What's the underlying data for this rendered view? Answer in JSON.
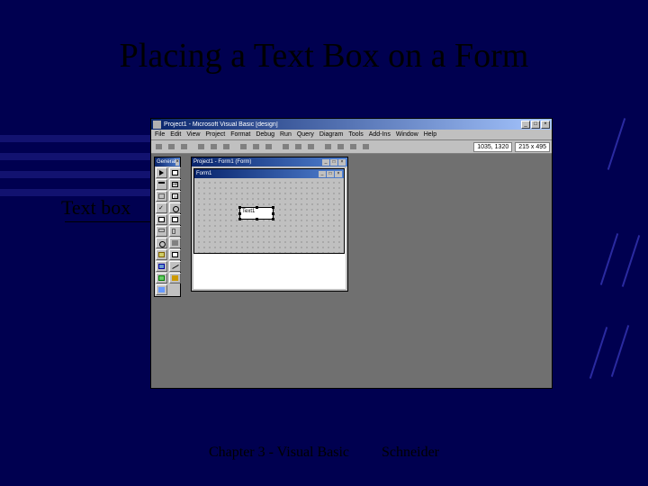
{
  "slide": {
    "title": "Placing a Text Box on a Form",
    "annotation": "Text box",
    "footer_left": "Chapter 3 - Visual Basic",
    "footer_right": "Schneider"
  },
  "vb": {
    "app_title": "Project1 - Microsoft Visual Basic [design]",
    "menu": [
      "File",
      "Edit",
      "View",
      "Project",
      "Format",
      "Debug",
      "Run",
      "Query",
      "Diagram",
      "Tools",
      "Add-Ins",
      "Window",
      "Help"
    ],
    "coords1": "1035, 1320",
    "coords2": "215 x 495",
    "toolbox_title": "General",
    "formwin_title": "Project1 - Form1 (Form)",
    "innerform_title": "Form1",
    "textbox_value": "Text1"
  }
}
